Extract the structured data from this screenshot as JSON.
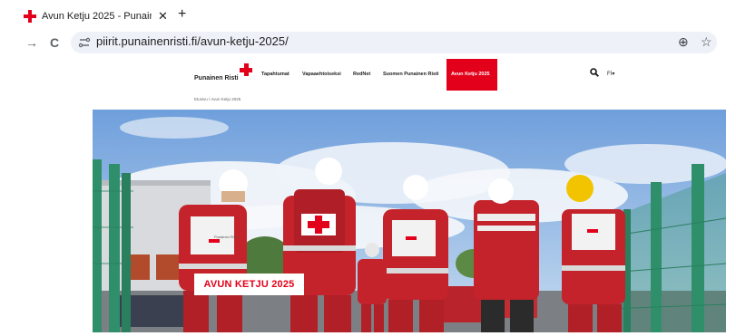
{
  "browser": {
    "tab_title": "Avun Ketju 2025 - Punainen Ris",
    "tab_close": "✕",
    "new_tab": "+",
    "back": "→",
    "reload": "C",
    "url": "piirit.punainenristi.fi/avun-ketju-2025/",
    "zoom_icon": "⊕",
    "bookmark_icon": "☆"
  },
  "site": {
    "logo_text": "Punainen Risti",
    "nav": [
      "Tapahtumat",
      "Vapaaehtoiseksi",
      "RedNet",
      "Suomen Punainen Risti"
    ],
    "nav_active": "Avun Ketju 2025",
    "lang": "FI",
    "lang_caret": "▾"
  },
  "breadcrumb": {
    "home": "Etusivu",
    "separator": "/",
    "current": "Avun Ketju 2025"
  },
  "hero": {
    "title": "AVUN KETJU 2025",
    "vest_label": "Punainen Risti"
  },
  "colors": {
    "brand_red": "#e2001a",
    "sky": "#8fb7e6",
    "fence_green": "#2f8f6b"
  }
}
